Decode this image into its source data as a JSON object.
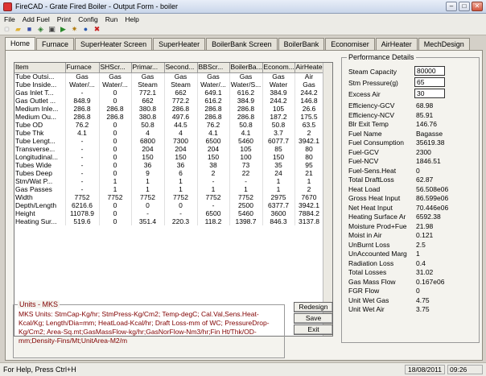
{
  "window": {
    "title": "FireCAD - Grate Fired Boiler - Output Form - boiler",
    "icon": "app-icon"
  },
  "menu": [
    "File",
    "Add Fuel",
    "Print",
    "Config",
    "Run",
    "Help"
  ],
  "toolbar": [
    {
      "icon": "new-icon",
      "glyph": "■"
    },
    {
      "icon": "open-folder-icon",
      "glyph": "▰"
    },
    {
      "icon": "save-icon",
      "glyph": "■"
    },
    {
      "icon": "refresh-icon",
      "glyph": "◈"
    },
    {
      "icon": "print-icon",
      "glyph": "▣"
    },
    {
      "icon": "run-icon",
      "glyph": "▶"
    },
    {
      "icon": "settings-icon",
      "glyph": "✷"
    },
    {
      "icon": "info-icon",
      "glyph": "●"
    },
    {
      "icon": "stop-icon",
      "glyph": "✖"
    }
  ],
  "tabs": [
    "Home",
    "Furnace",
    "SuperHeater Screen",
    "SuperHeater",
    "BoilerBank Screen",
    "BoilerBank",
    "Economiser",
    "AirHeater",
    "MechDesign"
  ],
  "active_tab": "Home",
  "grid": {
    "columns": [
      "Item",
      "Furnace",
      "SHScr...",
      "Primar...",
      "Second...",
      "BBScr...",
      "BoilerBa...",
      "Econom...",
      "AirHeater"
    ],
    "rows": [
      [
        "Tube Outsi...",
        "Gas",
        "Gas",
        "Gas",
        "Gas",
        "Gas",
        "Gas",
        "Gas",
        "Air"
      ],
      [
        "Tube Inside...",
        "Water/...",
        "Water/...",
        "Steam",
        "Steam",
        "Water/...",
        "Water/S...",
        "Water",
        "Gas"
      ],
      [
        "Gas Inlet T...",
        "-",
        "0",
        "772.1",
        "662",
        "649.1",
        "616.2",
        "384.9",
        "244.2"
      ],
      [
        "Gas Outlet ...",
        "848.9",
        "0",
        "662",
        "772.2",
        "616.2",
        "384.9",
        "244.2",
        "146.8"
      ],
      [
        "Medium Inle...",
        "286.8",
        "286.8",
        "380.8",
        "286.8",
        "286.8",
        "286.8",
        "105",
        "26.6"
      ],
      [
        "Medium Ou...",
        "286.8",
        "286.8",
        "380.8",
        "497.6",
        "286.8",
        "286.8",
        "187.2",
        "175.5"
      ],
      [
        "Tube OD",
        "76.2",
        "0",
        "50.8",
        "44.5",
        "76.2",
        "50.8",
        "50.8",
        "63.5"
      ],
      [
        "Tube Thk",
        "4.1",
        "0",
        "4",
        "4",
        "4.1",
        "4.1",
        "3.7",
        "2"
      ],
      [
        "Tube Lengt...",
        "-",
        "0",
        "6800",
        "7300",
        "6500",
        "5460",
        "6077.7",
        "3942.1"
      ],
      [
        "Transverse...",
        "-",
        "0",
        "204",
        "204",
        "204",
        "105",
        "85",
        "80"
      ],
      [
        "Longitudinal...",
        "-",
        "0",
        "150",
        "150",
        "150",
        "100",
        "150",
        "80"
      ],
      [
        "Tubes Wide",
        "-",
        "0",
        "36",
        "36",
        "38",
        "73",
        "35",
        "95"
      ],
      [
        "Tubes Deep",
        "-",
        "0",
        "9",
        "6",
        "2",
        "22",
        "24",
        "21"
      ],
      [
        "Stm/Wat P...",
        "-",
        "1",
        "1",
        "1",
        "-",
        "-",
        "1",
        "1"
      ],
      [
        "Gas Passes",
        "-",
        "1",
        "1",
        "1",
        "1",
        "1",
        "1",
        "2"
      ],
      [
        "Width",
        "7752",
        "7752",
        "7752",
        "7752",
        "7752",
        "7752",
        "2975",
        "7670"
      ],
      [
        "Depth/Length",
        "6216.6",
        "0",
        "0",
        "0",
        "-",
        "2500",
        "6377.7",
        "3942.1"
      ],
      [
        "Height",
        "11078.9",
        "0",
        "-",
        "-",
        "6500",
        "5460",
        "3600",
        "7884.2"
      ],
      [
        "Heating Sur...",
        "519.6",
        "0",
        "351.4",
        "220.3",
        "118.2",
        "1398.7",
        "846.3",
        "3137.8"
      ]
    ]
  },
  "performance": {
    "legend": "Performance Details",
    "inputs": [
      {
        "label": "Steam Capacity",
        "value": "80000"
      },
      {
        "label": "Stm Pressure(g)",
        "value": "65"
      },
      {
        "label": "Excess Air",
        "value": "30"
      }
    ],
    "values": [
      {
        "label": "Efficiency-GCV",
        "value": "68.98"
      },
      {
        "label": "Efficiency-NCV",
        "value": "85.91"
      },
      {
        "label": "Blr Exit Temp",
        "value": "146.76"
      },
      {
        "label": "Fuel Name",
        "value": "Bagasse"
      },
      {
        "label": "Fuel Consumption",
        "value": "35619.38"
      },
      {
        "label": "Fuel-GCV",
        "value": "2300"
      },
      {
        "label": "Fuel-NCV",
        "value": "1846.51"
      },
      {
        "label": "Fuel-Sens.Heat",
        "value": "0"
      },
      {
        "label": "Total DraftLoss",
        "value": "62.87"
      },
      {
        "label": "Heat Load",
        "value": "56.508e06"
      },
      {
        "label": "Gross Heat Input",
        "value": "86.599e06"
      },
      {
        "label": "Net Heat Input",
        "value": "70.446e06"
      },
      {
        "label": "Heating Surface Ar",
        "value": "6592.38"
      },
      {
        "label": "Moisture Prod+Fue",
        "value": "21.98"
      },
      {
        "label": "Moist in Air",
        "value": "0.121"
      },
      {
        "label": "UnBurnt Loss",
        "value": "2.5"
      },
      {
        "label": "UnAccounted Marg",
        "value": "1"
      },
      {
        "label": "Radiation Loss",
        "value": "0.4"
      },
      {
        "label": "Total Losses",
        "value": "31.02"
      },
      {
        "label": "Gas Mass Flow",
        "value": "0.167e06"
      },
      {
        "label": "FGR Flow",
        "value": "0"
      },
      {
        "label": "Unit Wet Gas",
        "value": "4.75"
      },
      {
        "label": "Unit Wet Air",
        "value": "3.75"
      }
    ]
  },
  "units": {
    "legend": "Units - MKS",
    "text": "MKS Units: StmCap-Kg/hr; StmPress-Kg/Cm2; Temp-degC; Cal.Val,Sens.Heat-Kcal/Kg; Length/Dia=mm; HeatLoad-Kcal/hr; Draft Loss-mm of WC; PressureDrop-Kg/Cm2; Area-Sq.mt;GasMassFlow-kg/hr;GasNorFlow-Nm3/hr;Fin Ht/Thk/OD-mm;Density-Fins/Mt;UnitArea-M2/m"
  },
  "buttons": {
    "redesign": "Redesign",
    "save": "Save",
    "exit": "Exit"
  },
  "status": {
    "help": "For Help, Press Ctrl+H",
    "date": "18/08/2011",
    "time": "09:26"
  }
}
